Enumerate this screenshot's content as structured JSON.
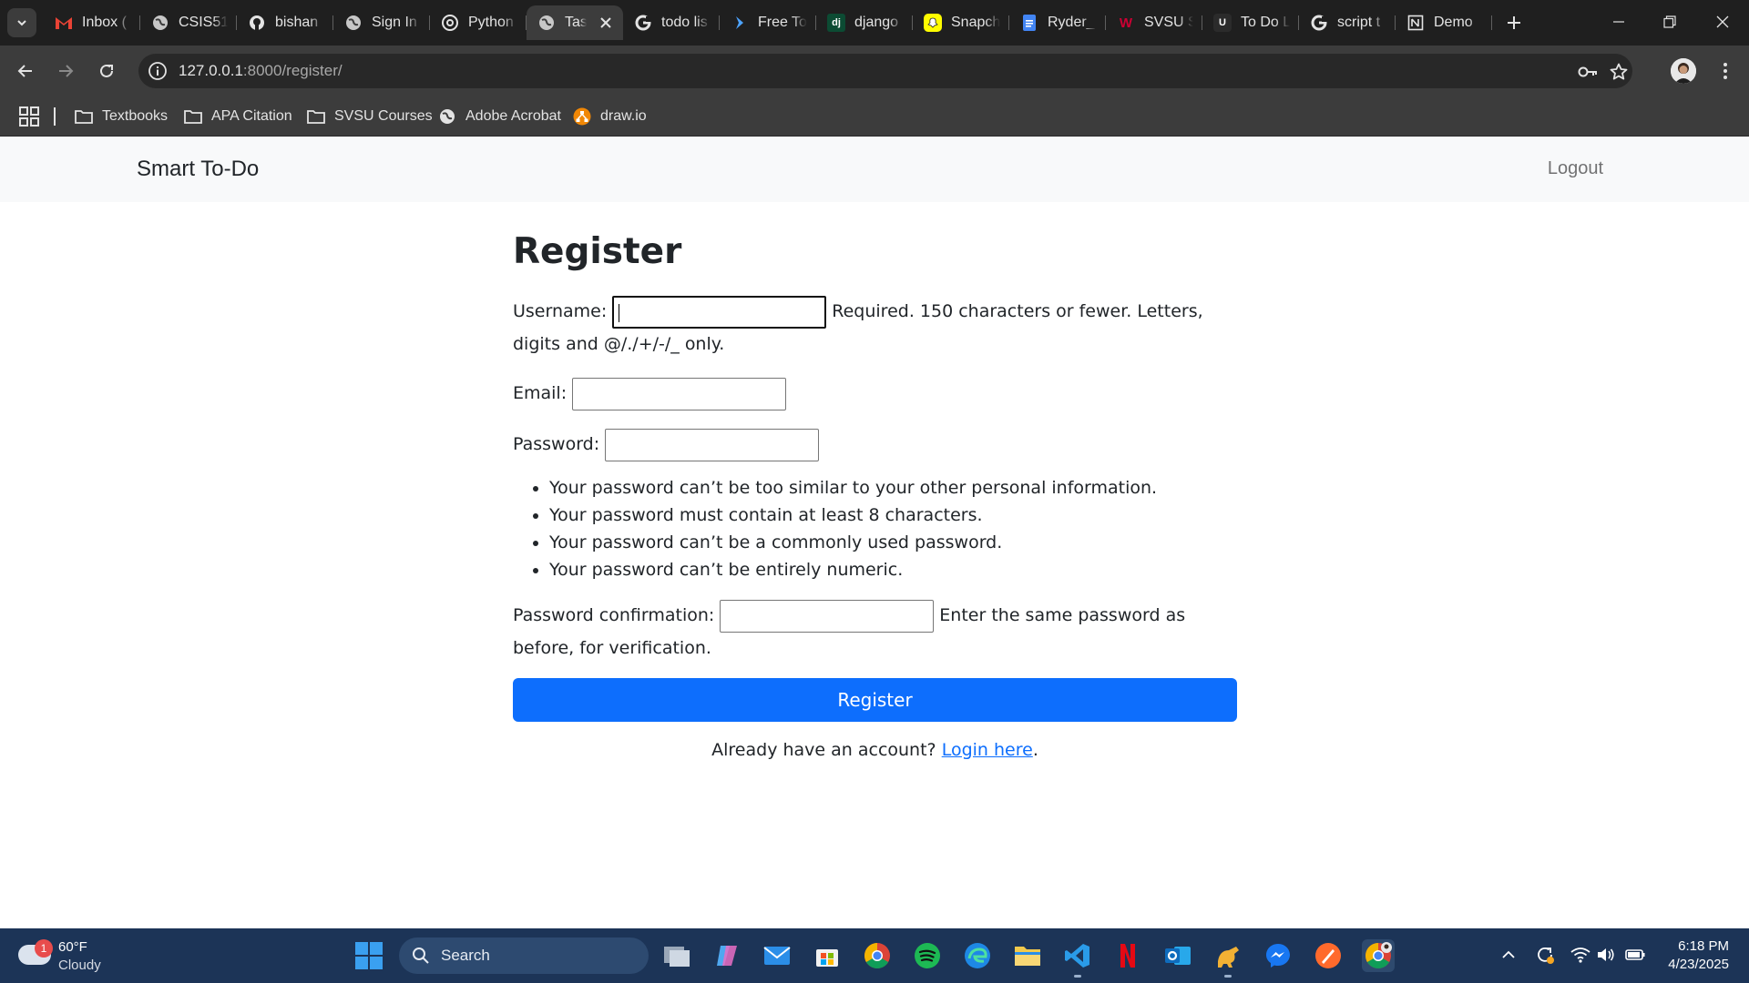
{
  "browser": {
    "tabs": [
      {
        "title": "Inbox (",
        "icon": "gmail-icon",
        "color": "#ea4335"
      },
      {
        "title": "CSIS51",
        "icon": "globe-icon",
        "color": "#e3e3e3"
      },
      {
        "title": "bishan",
        "icon": "github-icon",
        "color": "#e3e3e3"
      },
      {
        "title": "Sign In",
        "icon": "globe-icon",
        "color": "#e3e3e3"
      },
      {
        "title": "Python",
        "icon": "chatgpt-icon",
        "color": "#e3e3e3"
      },
      {
        "title": "Tas",
        "icon": "globe-icon",
        "color": "#e3e3e3",
        "active": true
      },
      {
        "title": "todo lis",
        "icon": "google-icon",
        "color": "#e3e3e3"
      },
      {
        "title": "Free To",
        "icon": "arrow-logo-icon",
        "color": "#4da3ff"
      },
      {
        "title": "django",
        "icon": "django-icon",
        "color": "#0c4b33"
      },
      {
        "title": "Snapch",
        "icon": "snapchat-icon",
        "color": "#fffc00"
      },
      {
        "title": "Ryder_",
        "icon": "docs-icon",
        "color": "#4285f4"
      },
      {
        "title": "SVSU S",
        "icon": "svsu-icon",
        "color": "#cc0033"
      },
      {
        "title": "To Do L",
        "icon": "todo-icon",
        "color": "#e3e3e3"
      },
      {
        "title": "script t",
        "icon": "google-icon",
        "color": "#e3e3e3"
      },
      {
        "title": "Demo",
        "icon": "notion-icon",
        "color": "#e3e3e3"
      }
    ],
    "url_host": "127.0.0.1",
    "url_path": ":8000/register/",
    "bookmarks": [
      {
        "label": "Textbooks",
        "icon": "folder-icon"
      },
      {
        "label": "APA Citation",
        "icon": "folder-icon"
      },
      {
        "label": "SVSU Courses",
        "icon": "folder-icon"
      },
      {
        "label": "Adobe Acrobat",
        "icon": "globe-icon"
      },
      {
        "label": "draw.io",
        "icon": "drawio-icon"
      }
    ]
  },
  "site": {
    "brand": "Smart To-Do",
    "logout": "Logout"
  },
  "form": {
    "title": "Register",
    "username_label": "Username:",
    "username_help": "Required. 150 characters or fewer. Letters, digits and @/./+/-/_ only.",
    "username_value": "",
    "email_label": "Email:",
    "email_value": "",
    "password_label": "Password:",
    "password_value": "",
    "password_rules": [
      "Your password can’t be too similar to your other personal information.",
      "Your password must contain at least 8 characters.",
      "Your password can’t be a commonly used password.",
      "Your password can’t be entirely numeric."
    ],
    "confirm_label": "Password confirmation:",
    "confirm_help": "Enter the same password as before, for verification.",
    "confirm_value": "",
    "submit_label": "Register",
    "login_prompt": "Already have an account?",
    "login_link": "Login here",
    "login_suffix": ".",
    "primary_color": "#0d6efd"
  },
  "taskbar": {
    "weather_badge": "1",
    "temperature": "60°F",
    "condition": "Cloudy",
    "search_label": "Search",
    "apps": [
      "task-view-icon",
      "copilot-icon",
      "mail-icon",
      "store-icon",
      "chrome-icon",
      "spotify-icon",
      "edge-icon",
      "file-explorer-icon",
      "vscode-icon",
      "netflix-icon",
      "outlook-icon",
      "dino-icon",
      "messenger-icon",
      "app-icon",
      "chrome-profile-icon"
    ],
    "time": "6:18 PM",
    "date": "4/23/2025"
  }
}
